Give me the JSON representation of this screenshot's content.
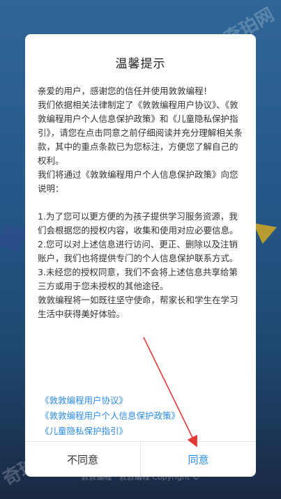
{
  "watermark": "奇珀网",
  "footer_text": "敦敦编程 · 敦敦编程 Copyright ©",
  "dialog": {
    "title": "温馨提示",
    "paragraphs": [
      "亲爱的用户，感谢您的信任并使用敦敦编程！",
      "我们依据相关法律制定了《敦敦编程用户协议》、《敦敦编程用户个人信息保护政策》和《儿童隐私保护指引》，请您在点击同意之前仔细阅读并充分理解相关条款，其中的重点条款已为您标注，方便您了解自己的权利。",
      "我们将通过《敦敦编程用户个人信息保护政策》向您说明：",
      "",
      "1.为了您可以更方便的为孩子提供学习服务资源，我们会根据您的授权内容，收集和使用对应必要信息。",
      "2.您可以对上述信息进行访问、更正、删除以及注销账户，我们也将提供专门的个人信息保护联系方式。",
      "3.未经您的授权同意，我们不会将上述信息共享给第三方或用于您未授权的其他途径。",
      "敦敦编程将一如既往坚守使命，帮家长和学生在学习生活中获得美好体验。"
    ],
    "links": [
      "《敦敦编程用户协议》",
      "《敦敦编程用户个人信息保护政策》",
      "《儿童隐私保护指引》"
    ],
    "disagree_label": "不同意",
    "agree_label": "同意"
  },
  "colors": {
    "accent": "#2b8be6",
    "annotation_arrow": "#e53935"
  }
}
